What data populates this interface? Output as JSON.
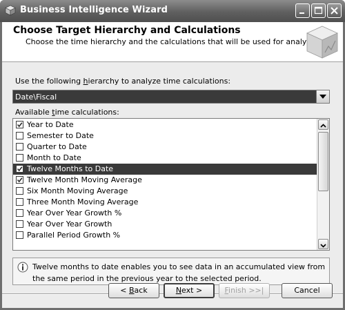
{
  "window": {
    "title": "Business Intelligence Wizard",
    "icon": "cube-app-icon",
    "controls": [
      "minimize-icon",
      "maximize-icon",
      "close-icon"
    ]
  },
  "header": {
    "title": "Choose Target Hierarchy and Calculations",
    "subtitle": "Choose the time hierarchy and the calculations that will be used for analysis."
  },
  "hierarchy": {
    "label_pre": "Use the following ",
    "label_access": "h",
    "label_post": "ierarchy to analyze time calculations:",
    "selected": "Date\\Fiscal"
  },
  "calculations": {
    "label_pre": "Available ",
    "label_access": "t",
    "label_post": "ime calculations:",
    "items": [
      {
        "label": "Year to Date",
        "checked": true,
        "selected": false
      },
      {
        "label": "Semester to Date",
        "checked": false,
        "selected": false
      },
      {
        "label": "Quarter to Date",
        "checked": false,
        "selected": false
      },
      {
        "label": "Month to Date",
        "checked": false,
        "selected": false
      },
      {
        "label": "Twelve Months to Date",
        "checked": true,
        "selected": true
      },
      {
        "label": "Twelve Month Moving Average",
        "checked": true,
        "selected": false
      },
      {
        "label": "Six Month Moving Average",
        "checked": false,
        "selected": false
      },
      {
        "label": "Three Month Moving Average",
        "checked": false,
        "selected": false
      },
      {
        "label": "Year Over Year Growth %",
        "checked": false,
        "selected": false
      },
      {
        "label": "Year Over Year Growth",
        "checked": false,
        "selected": false
      },
      {
        "label": "Parallel Period Growth %",
        "checked": false,
        "selected": false
      }
    ]
  },
  "description": {
    "icon": "info-icon",
    "text": "Twelve months to date enables you to see data in an accumulated view from the same period in the previous year to the selected period."
  },
  "buttons": {
    "back_pre": "< ",
    "back_access": "B",
    "back_post": "ack",
    "next_access": "N",
    "next_post": "ext >",
    "finish_access": "F",
    "finish_post": "inish >>|",
    "cancel": "Cancel"
  }
}
